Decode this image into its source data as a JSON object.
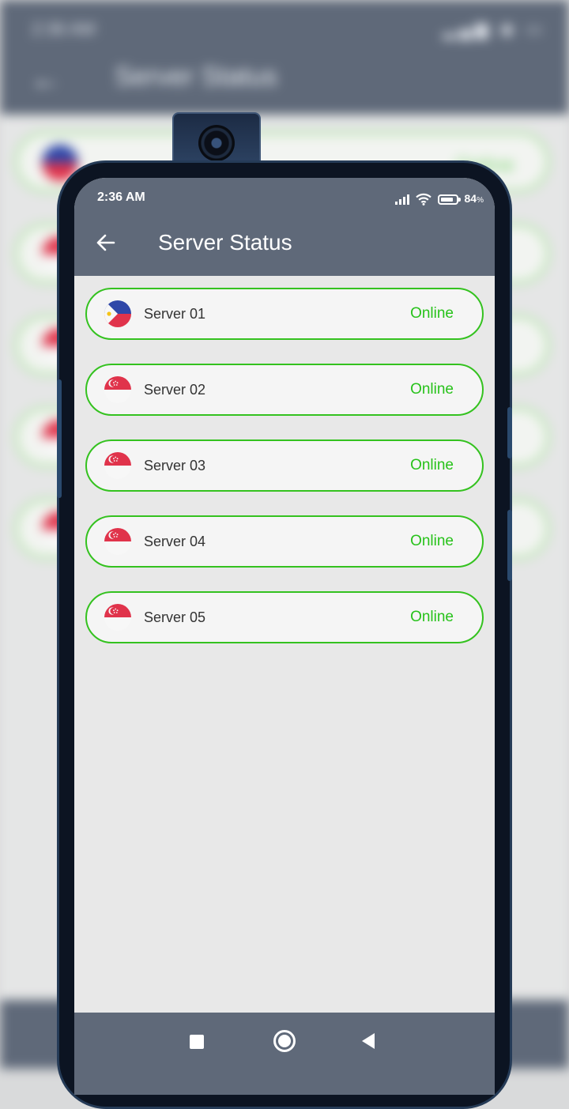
{
  "status_bar": {
    "time": "2:36 AM",
    "battery_percent": "84",
    "battery_suffix": "%",
    "icons": [
      "signal-icon",
      "wifi-icon",
      "battery-icon"
    ]
  },
  "app_bar": {
    "back_icon": "arrow-left-icon",
    "title": "Server Status"
  },
  "servers": [
    {
      "name": "Server 01",
      "status": "Online",
      "flag": "philippines-flag-icon"
    },
    {
      "name": "Server 02",
      "status": "Online",
      "flag": "singapore-flag-icon"
    },
    {
      "name": "Server 03",
      "status": "Online",
      "flag": "singapore-flag-icon"
    },
    {
      "name": "Server 04",
      "status": "Online",
      "flag": "singapore-flag-icon"
    },
    {
      "name": "Server 05",
      "status": "Online",
      "flag": "singapore-flag-icon"
    }
  ],
  "nav_bar": {
    "icons": [
      "recents-square-icon",
      "home-circle-icon",
      "back-triangle-icon"
    ]
  },
  "colors": {
    "app_bar": "#5f6979",
    "online": "#27c21a",
    "row_border": "#34c21f",
    "background": "#e8e8e8"
  }
}
